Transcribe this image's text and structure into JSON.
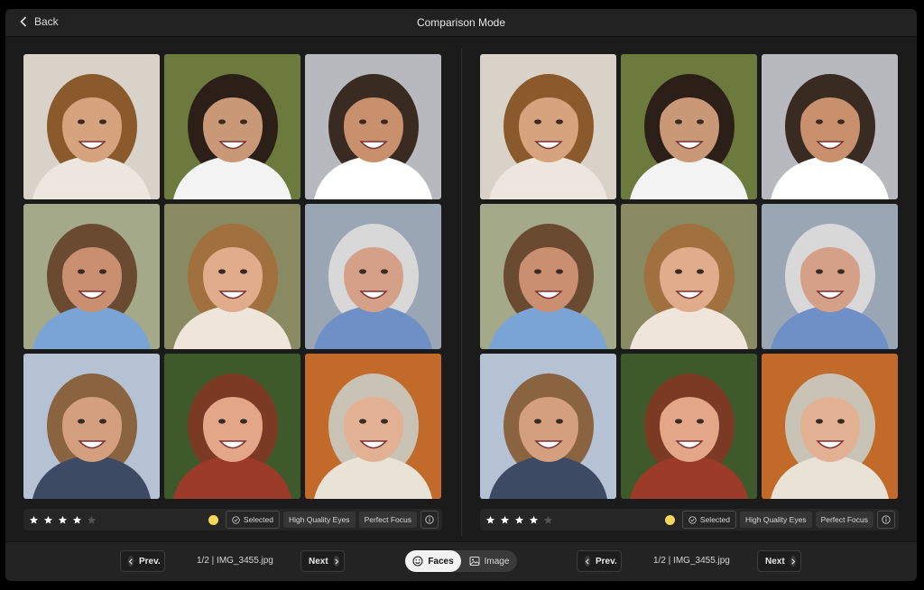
{
  "header": {
    "back_label": "Back",
    "title": "Comparison Mode"
  },
  "panes": [
    {
      "rating": 4,
      "max_rating": 5,
      "color_label": "#f4d85c",
      "tags": {
        "selected": "Selected",
        "eyes": "High Quality Eyes",
        "focus": "Perfect Focus"
      },
      "nav": {
        "prev": "Prev.",
        "next": "Next",
        "position": "1/2 | IMG_3455.jpg"
      }
    },
    {
      "rating": 4,
      "max_rating": 5,
      "color_label": "#f4d85c",
      "tags": {
        "selected": "Selected",
        "eyes": "High Quality Eyes",
        "focus": "Perfect Focus"
      },
      "nav": {
        "prev": "Prev.",
        "next": "Next",
        "position": "1/2 | IMG_3455.jpg"
      }
    }
  ],
  "view_toggle": {
    "faces": "Faces",
    "image": "Image",
    "active": "faces"
  },
  "colors": {
    "star_on": "#ffffff",
    "star_off": "#555555",
    "accent_label": "#f4d85c"
  },
  "faces": [
    {
      "bg": "#d9d2c8",
      "skin": "#d6a37f",
      "hair": "#8a5a2c",
      "shirt": "#ece6df"
    },
    {
      "bg": "#6d7a3e",
      "skin": "#c99877",
      "hair": "#2b1f18",
      "shirt": "#f3f3f3"
    },
    {
      "bg": "#b7b9bf",
      "skin": "#c9906e",
      "hair": "#3a2b22",
      "shirt": "#ffffff"
    },
    {
      "bg": "#a4a98a",
      "skin": "#c98f70",
      "hair": "#6a4a30",
      "shirt": "#7aa3d6"
    },
    {
      "bg": "#8a8a62",
      "skin": "#e0ac8c",
      "hair": "#a0703e",
      "shirt": "#efe5da"
    },
    {
      "bg": "#9aa6b4",
      "skin": "#d4a188",
      "hair": "#d8d8d8",
      "shirt": "#6f8fc7"
    },
    {
      "bg": "#b5c2d4",
      "skin": "#d39f7f",
      "hair": "#8a6440",
      "shirt": "#3c4a64"
    },
    {
      "bg": "#3f5a2a",
      "skin": "#e3a688",
      "hair": "#7a3a24",
      "shirt": "#9d3b2a"
    },
    {
      "bg": "#c26a2a",
      "skin": "#e2b093",
      "hair": "#c9c3b6",
      "shirt": "#e9e2d6"
    }
  ]
}
